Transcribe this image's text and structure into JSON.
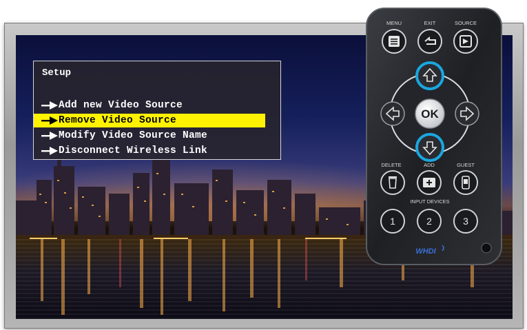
{
  "osd": {
    "title": "Setup",
    "items": [
      {
        "label": "Add new Video Source",
        "selected": false
      },
      {
        "label": "Remove Video Source",
        "selected": true
      },
      {
        "label": "Modify Video Source Name",
        "selected": false
      },
      {
        "label": "Disconnect Wireless Link",
        "selected": false
      }
    ],
    "highlight_color": "#fff200"
  },
  "remote": {
    "top_labels": {
      "menu": "MENU",
      "exit": "EXIT",
      "source": "SOURCE"
    },
    "ok_label": "OK",
    "bottom_labels": {
      "delete": "DELETE",
      "add": "ADD",
      "guest": "GUEST"
    },
    "input_devices_label": "INPUT DEVICES",
    "input_buttons": [
      "1",
      "2",
      "3"
    ],
    "brand": "WHDI",
    "highlight_color": "#1aa7e0",
    "highlighted_buttons": [
      "up-arrow-button",
      "down-arrow-button"
    ]
  }
}
